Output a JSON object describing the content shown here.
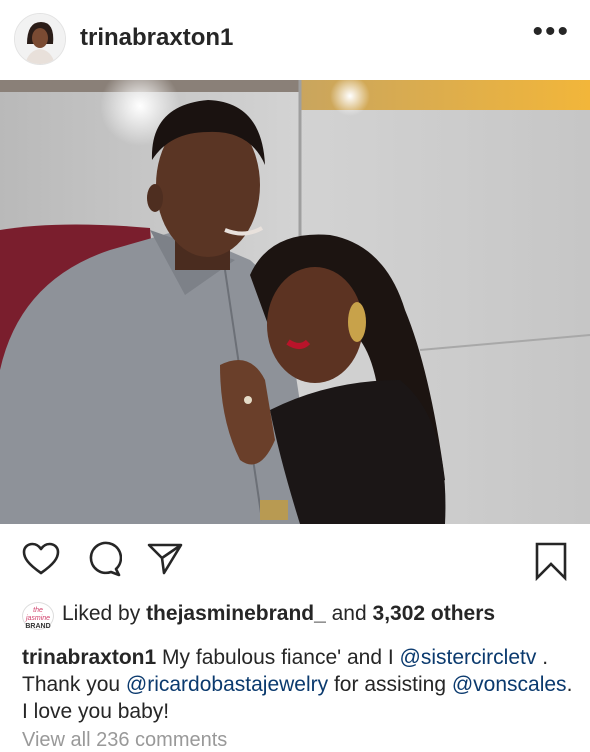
{
  "header": {
    "username": "trinabraxton1",
    "more_label": "•••",
    "avatar_icon": "profile-avatar"
  },
  "photo": {
    "icon": "couple-photo"
  },
  "actions": {
    "like_icon": "heart-icon",
    "comment_icon": "comment-icon",
    "share_icon": "share-icon",
    "save_icon": "bookmark-icon"
  },
  "likes": {
    "avatar_line1": "the jasmine",
    "avatar_line2": "BRAND",
    "prefix": "Liked by ",
    "liker": "thejasminebrand_",
    "middle": " and ",
    "count": "3,302 others"
  },
  "caption": {
    "username": "trinabraxton1",
    "part1": " My fabulous fiance' and I ",
    "mention1": "@sistercircletv",
    "part2": " . Thank you ",
    "mention2": "@ricardobastajewelry",
    "part3": " for assisting ",
    "mention3": "@vonscales",
    "part4": ". I love you baby!"
  },
  "comments": {
    "view_all": "View all 236 comments"
  },
  "colors": {
    "text": "#262626",
    "mention": "#0b3a6e",
    "muted": "#999999"
  }
}
